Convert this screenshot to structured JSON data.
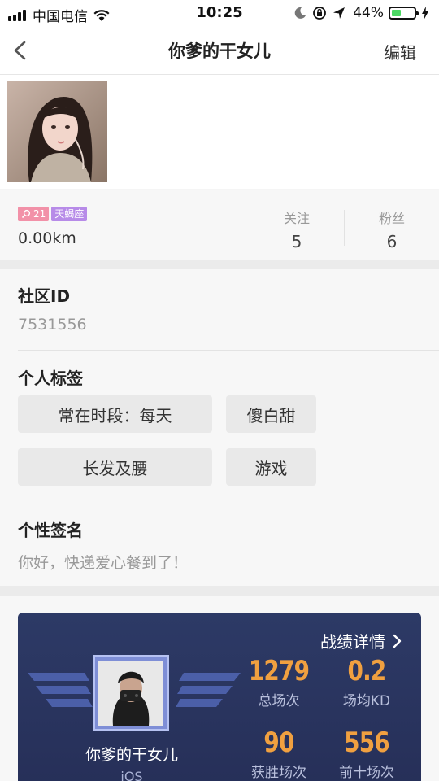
{
  "status_bar": {
    "carrier": "中国电信",
    "time": "10:25",
    "battery_pct": "44%",
    "battery_level": 0.44
  },
  "nav": {
    "title": "你爹的干女儿",
    "edit_label": "编辑"
  },
  "profile": {
    "age_badge": "21",
    "zodiac_badge": "天蝎座",
    "distance": "0.00km",
    "following_label": "关注",
    "following_count": "5",
    "fans_label": "粉丝",
    "fans_count": "6"
  },
  "details": {
    "community_id_label": "社区ID",
    "community_id_value": "7531556",
    "tags_label": "个人标签",
    "tags": [
      "常在时段：每天",
      "傻白甜",
      "长发及腰",
      "游戏"
    ],
    "signature_label": "个性签名",
    "signature_value": "你好，快递爱心餐到了！"
  },
  "game_card": {
    "details_link": "战绩详情",
    "player_name": "你爹的干女儿",
    "platform": "iOS",
    "stats": [
      {
        "value": "1279",
        "label": "总场次"
      },
      {
        "value": "0.2",
        "label": "场均KD"
      },
      {
        "value": "90",
        "label": "获胜场次"
      },
      {
        "value": "556",
        "label": "前十场次"
      }
    ]
  },
  "colors": {
    "accent_orange": "#f0a040",
    "card_bg": "#2d3a66",
    "age_badge": "#f291a8",
    "zodiac_badge": "#b78be8"
  },
  "icons": [
    "back-chevron-icon",
    "wifi-icon",
    "moon-icon",
    "lock-rotation-icon",
    "location-icon",
    "battery-icon",
    "charging-icon",
    "search-icon",
    "chevron-right-icon"
  ]
}
